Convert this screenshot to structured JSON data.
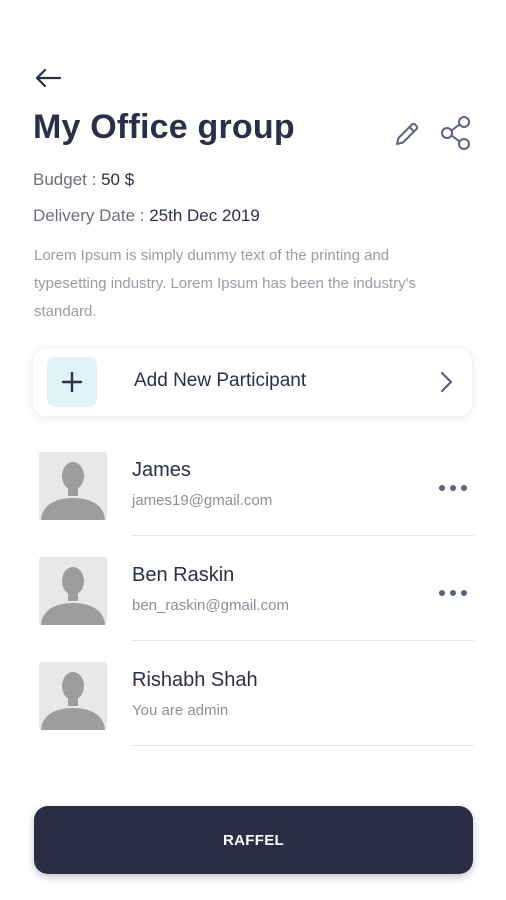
{
  "header": {
    "back_icon": "arrow-left-icon",
    "title": "My Office group",
    "edit_icon": "pencil-icon",
    "share_icon": "share-icon"
  },
  "details": {
    "budget_label": "Budget :",
    "budget_value": "50 $",
    "delivery_label": "Delivery Date :",
    "delivery_value": "25th Dec 2019",
    "description": "Lorem Ipsum is simply dummy text of the printing and typesetting industry. Lorem Ipsum has been the industry's standard."
  },
  "add_participant": {
    "label": "Add New Participant",
    "icon": "plus-icon",
    "accent": "#dff3f9"
  },
  "participants": [
    {
      "name": "James",
      "subtitle": "james19@gmail.com",
      "has_menu": true
    },
    {
      "name": "Ben Raskin",
      "subtitle": "ben_raskin@gmail.com",
      "has_menu": true
    },
    {
      "name": "Rishabh Shah",
      "subtitle": "You are admin",
      "has_menu": false
    }
  ],
  "footer": {
    "button_label": "RAFFEL",
    "button_color": "#2b2d45"
  }
}
